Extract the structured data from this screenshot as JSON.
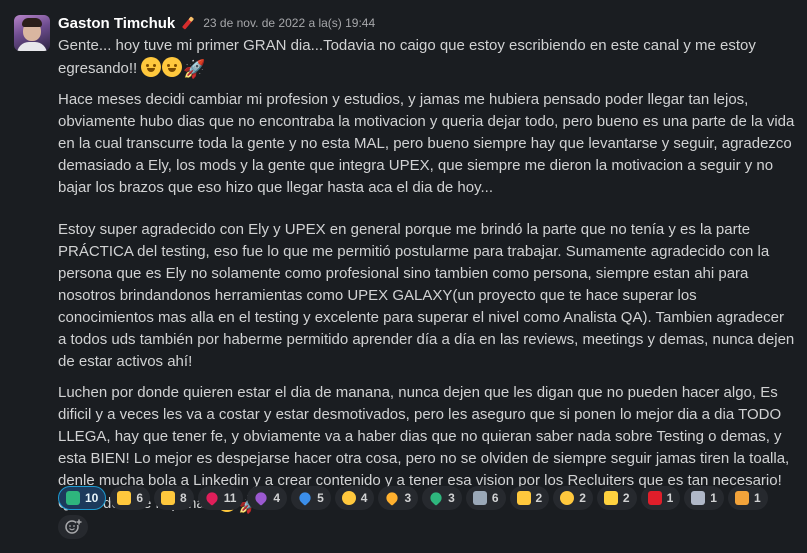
{
  "message": {
    "author": "Gaston Timchuk",
    "timestamp": "23 de nov. de 2022 a la(s) 19:44",
    "paragraphs": [
      "Gente... hoy tuve mi primer GRAN dia...Todavia no caigo que estoy escribiendo en este canal y me estoy egresando!!",
      "Hace meses decidi cambiar mi profesion y estudios, y jamas me hubiera pensado poder llegar tan lejos, obviamente hubo dias que no encontraba la motivacion y queria dejar todo, pero bueno es una parte de la vida en la cual transcurre toda la gente y no esta MAL, pero bueno siempre hay que levantarse y seguir, agradezco demasiado a Ely, los mods y la gente que integra UPEX, que siempre me dieron la motivacion a seguir y no bajar los brazos que eso hizo que llegar hasta aca el dia de hoy...",
      "Estoy super agradecido con Ely y UPEX en general porque me brindó la parte que no tenía y es la parte PRÁCTICA del testing, eso fue lo que me permitió postularme para trabajar. Sumamente agradecido con la persona que es Ely no solamente como profesional sino tambien como persona, siempre estan ahi para nosotros brindandonos herramientas como UPEX GALAXY(un proyecto que te hace superar los conocimientos mas alla en el testing y excelente para superar el nivel como Analista QA). Tambien agradecer a todos uds también por haberme permitido aprender día a día en las reviews, meetings y demas, nunca dejen de estar activos ahí!",
      "Luchen por donde quieren estar el dia de manana, nunca dejen que les digan que no pueden hacer algo, Es dificil y a veces les va a costar y estar desmotivados, pero les aseguro que si ponen lo mejor dia a dia TODO LLEGA, hay que tener fe, y obviamente va a haber dias que no quieran saber nada sobre Testing o demas, y esta BIEN! Lo mejor es despejarse hacer otra cosa, pero no se olviden de siempre seguir jamas tiren la toalla, denle mucha bola a Linkedin y a crear contenido y a tener esa vision por los Recluiters que es tan necesario! Que todo vale la pena!!"
    ]
  },
  "reactions": [
    {
      "icon": "check-mark-icon",
      "color": "#2eb67d",
      "count": "10",
      "mine": true
    },
    {
      "icon": "thumbs-up-icon",
      "color": "#ffc83d",
      "count": "6",
      "mine": false
    },
    {
      "icon": "raised-hands-icon",
      "color": "#ffc83d",
      "count": "8",
      "mine": false
    },
    {
      "icon": "red-heart-icon",
      "color": "#e01e5a",
      "count": "11",
      "mine": false
    },
    {
      "icon": "purple-heart-icon",
      "color": "#9b59d0",
      "count": "4",
      "mine": false
    },
    {
      "icon": "blue-heart-icon",
      "color": "#3b8eea",
      "count": "5",
      "mine": false
    },
    {
      "icon": "partying-face-icon",
      "color": "#ffc83d",
      "count": "4",
      "mine": false
    },
    {
      "icon": "smiling-face-with-hearts-icon",
      "color": "#ffb02e",
      "count": "3",
      "mine": false
    },
    {
      "icon": "green-heart-icon",
      "color": "#2eb67d",
      "count": "3",
      "mine": false
    },
    {
      "icon": "rocket-icon",
      "color": "#9aa8b8",
      "count": "6",
      "mine": false
    },
    {
      "icon": "love-you-gesture-icon",
      "color": "#ffc83d",
      "count": "2",
      "mine": false
    },
    {
      "icon": "sunglasses-face-icon",
      "color": "#ffc83d",
      "count": "2",
      "mine": false
    },
    {
      "icon": "sparkles-icon",
      "color": "#ffd23f",
      "count": "2",
      "mine": false
    },
    {
      "icon": "hundred-points-icon",
      "color": "#e01e2a",
      "count": "1",
      "mine": false
    },
    {
      "icon": "dancing-figure-icon",
      "color": "#b0b8c8",
      "count": "1",
      "mine": false
    },
    {
      "icon": "party-popper-icon",
      "color": "#f2a33a",
      "count": "1",
      "mine": false
    }
  ]
}
